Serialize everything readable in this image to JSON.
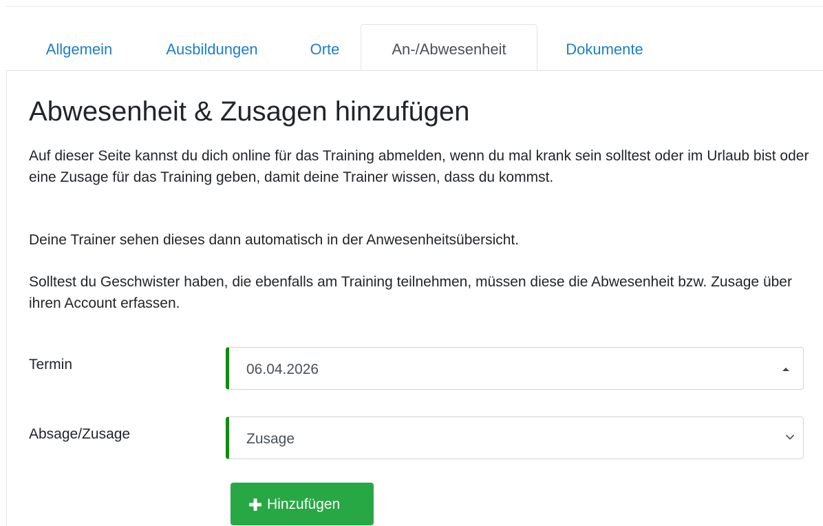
{
  "tabs": [
    {
      "label": "Allgemein",
      "active": false
    },
    {
      "label": "Ausbildungen",
      "active": false
    },
    {
      "label": "Orte",
      "active": false
    },
    {
      "label": "An-/Abwesenheit",
      "active": true
    },
    {
      "label": "Dokumente",
      "active": false
    }
  ],
  "page": {
    "title": "Abwesenheit & Zusagen hinzufügen",
    "intro_line": "Auf dieser Seite kannst du dich online für das Training abmelden, wenn du mal krank sein solltest oder im Urlaub bist oder eine Zusage für das Training geben, damit deine Trainer wissen, dass du kommst.",
    "intro_line2": "Deine Trainer sehen dieses dann automatisch in der Anwesenheitsübersicht.",
    "siblings_note": "Solltest du Geschwister haben, die ebenfalls am Training teilnehmen, müssen diese die Abwesenheit bzw. Zusage über ihren Account erfassen."
  },
  "form": {
    "termin": {
      "label": "Termin",
      "value": "06.04.2026",
      "icon": "caret-up-icon"
    },
    "status": {
      "label": "Absage/Zusage",
      "value": "Zusage",
      "icon": "chevron-down-icon"
    },
    "submit": {
      "label": "Hinzufügen",
      "icon": "plus-icon"
    }
  },
  "colors": {
    "link": "#1a7fc9",
    "valid_border": "#118a11",
    "button": "#28a745"
  }
}
